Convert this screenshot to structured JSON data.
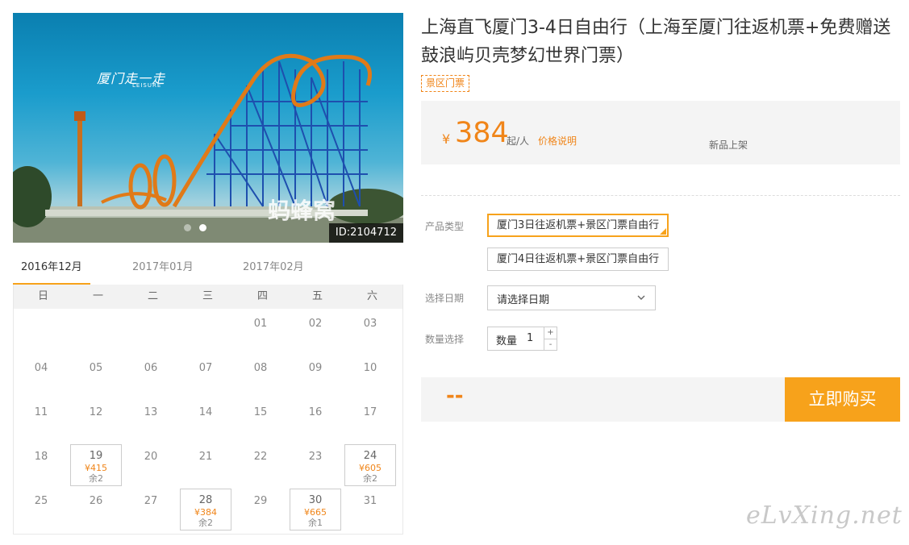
{
  "hero": {
    "logo": "厦门走一走",
    "logo_sub": "LEISURE",
    "watermark": "蚂蜂窝",
    "id_label": "ID:2104712",
    "slides": 2,
    "active_slide": 1
  },
  "product": {
    "title": "上海直飞厦门3-4日自由行（上海至厦门往返机票+免费赠送鼓浪屿贝壳梦幻世界门票）",
    "tag": "景区门票",
    "currency": "¥",
    "price": "384",
    "price_unit": "起/人",
    "price_note": "价格说明",
    "badge": "新品上架"
  },
  "options": {
    "type_label": "产品类型",
    "types": [
      {
        "label": "厦门3日往返机票+景区门票自由行",
        "selected": true
      },
      {
        "label": "厦门4日往返机票+景区门票自由行",
        "selected": false
      }
    ],
    "date_label": "选择日期",
    "date_placeholder": "请选择日期",
    "qty_label": "数量选择",
    "qty_inner_label": "数量",
    "qty_value": "1",
    "qty_plus": "+",
    "qty_minus": "-"
  },
  "purchase": {
    "total": "--",
    "buy_label": "立即购买"
  },
  "calendar": {
    "months": [
      "2016年12月",
      "2017年01月",
      "2017年02月"
    ],
    "active_month": 0,
    "weekdays": [
      "日",
      "一",
      "二",
      "三",
      "四",
      "五",
      "六"
    ],
    "first_weekday": 4,
    "days_in_month": 31,
    "prices": [
      {
        "day": "19",
        "price": "¥415",
        "stock": "余2"
      },
      {
        "day": "24",
        "price": "¥605",
        "stock": "余2"
      },
      {
        "day": "28",
        "price": "¥384",
        "stock": "余2"
      },
      {
        "day": "30",
        "price": "¥665",
        "stock": "余1"
      }
    ]
  },
  "site_watermark": "eLvXing.net",
  "colors": {
    "accent": "#f7a21b",
    "price": "#f08519"
  }
}
